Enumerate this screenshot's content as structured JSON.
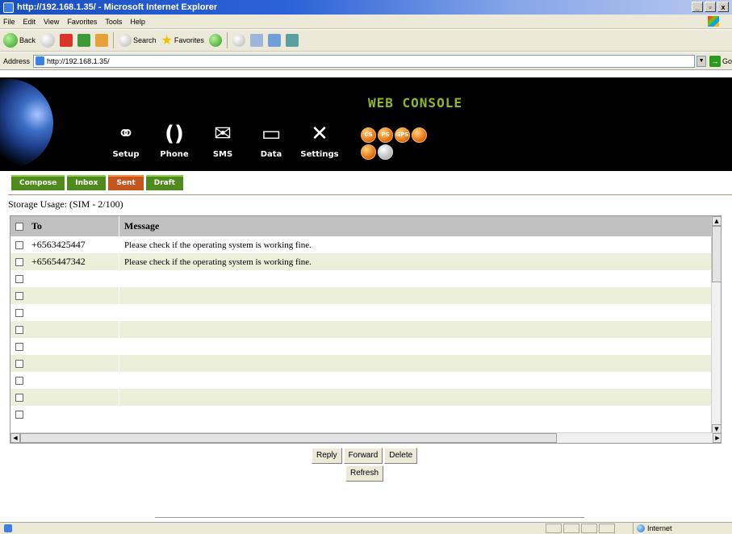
{
  "browser": {
    "title": "http://192.168.1.35/ - Microsoft Internet Explorer",
    "menu": [
      "File",
      "Edit",
      "View",
      "Favorites",
      "Tools",
      "Help"
    ],
    "toolbar": {
      "back": "Back",
      "search": "Search",
      "favorites": "Favorites"
    },
    "address_label": "Address",
    "address": "http://192.168.1.35/",
    "go": "Go",
    "status_zone": "Internet"
  },
  "console": {
    "title": "WEB CONSOLE",
    "nav": [
      {
        "label": "Setup",
        "icon": "link-icon"
      },
      {
        "label": "Phone",
        "icon": "phone-icon"
      },
      {
        "label": "SMS",
        "icon": "envelope-icon"
      },
      {
        "label": "Data",
        "icon": "monitor-icon"
      },
      {
        "label": "Settings",
        "icon": "tools-icon"
      }
    ],
    "status_icons": [
      "CS",
      "PS",
      "GPS",
      "",
      "",
      ""
    ]
  },
  "tabs": [
    {
      "label": "Compose",
      "active": false
    },
    {
      "label": "Inbox",
      "active": false
    },
    {
      "label": "Sent",
      "active": true
    },
    {
      "label": "Draft",
      "active": false
    }
  ],
  "storage": "Storage Usage: (SIM - 2/100)",
  "table": {
    "headers": {
      "to": "To",
      "message": "Message"
    },
    "rows": [
      {
        "to": "+6563425447",
        "message": "Please check if the operating system is working fine."
      },
      {
        "to": "+6565447342",
        "message": "Please check if the operating system is working fine."
      },
      {
        "to": "",
        "message": ""
      },
      {
        "to": "",
        "message": ""
      },
      {
        "to": "",
        "message": ""
      },
      {
        "to": "",
        "message": ""
      },
      {
        "to": "",
        "message": ""
      },
      {
        "to": "",
        "message": ""
      },
      {
        "to": "",
        "message": ""
      },
      {
        "to": "",
        "message": ""
      },
      {
        "to": "",
        "message": ""
      }
    ]
  },
  "actions": {
    "reply": "Reply",
    "forward": "Forward",
    "delete": "Delete",
    "refresh": "Refresh"
  },
  "colors": {
    "accent_green": "#8fb82b",
    "tab_green": "#4e8a1c",
    "tab_active": "#c5561f",
    "row_alt": "#ecefd9"
  }
}
